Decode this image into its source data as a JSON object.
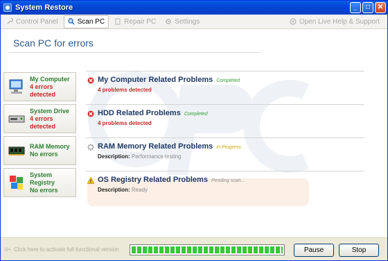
{
  "window": {
    "title": "System Restore"
  },
  "toolbar": {
    "items": [
      {
        "label": "Control Panel",
        "icon": "wrench-icon",
        "active": false
      },
      {
        "label": "Scan PC",
        "icon": "scan-icon",
        "active": true
      },
      {
        "label": "Repair PC",
        "icon": "document-icon",
        "active": false
      },
      {
        "label": "Settings",
        "icon": "gear-icon",
        "active": false
      }
    ],
    "help_label": "Open Live Help & Support"
  },
  "page": {
    "title": "Scan PC for errors"
  },
  "sidebar": {
    "items": [
      {
        "name": "My Computer",
        "status": "4 errors detected",
        "icon": "computer-icon"
      },
      {
        "name": "System Drive",
        "status": "4 errors detected",
        "icon": "drive-icon"
      },
      {
        "name": "RAM Memory",
        "status": "No errors",
        "icon": "ram-icon"
      },
      {
        "name": "System Registry",
        "status": "No errors",
        "icon": "registry-icon"
      }
    ]
  },
  "scan_rows": [
    {
      "title": "My Computer Related Problems",
      "status": "Completed",
      "detail": "4 problems detected",
      "icon": "error-icon"
    },
    {
      "title": "HDD Related Problems",
      "status": "Completed",
      "detail": "4 problems detected",
      "icon": "error-icon"
    },
    {
      "title": "RAM Memory Related Problems",
      "status": "In Progress",
      "detail_label": "Description:",
      "detail_value": "Performance testing",
      "icon": "spinner-icon"
    },
    {
      "title": "OS Registry Related Problems",
      "status": "Pending scan...",
      "detail_label": "Description:",
      "detail_value": "Ready",
      "icon": "warning-icon"
    }
  ],
  "statusbar": {
    "activate_text": "Click here to activate full-functional version",
    "progress": 1.0
  },
  "buttons": {
    "pause": "Pause",
    "stop": "Stop"
  },
  "colors": {
    "title_bar": "#0a5fe6",
    "error": "#c62828",
    "ok": "#2e7d32",
    "progress": "#37c837"
  }
}
